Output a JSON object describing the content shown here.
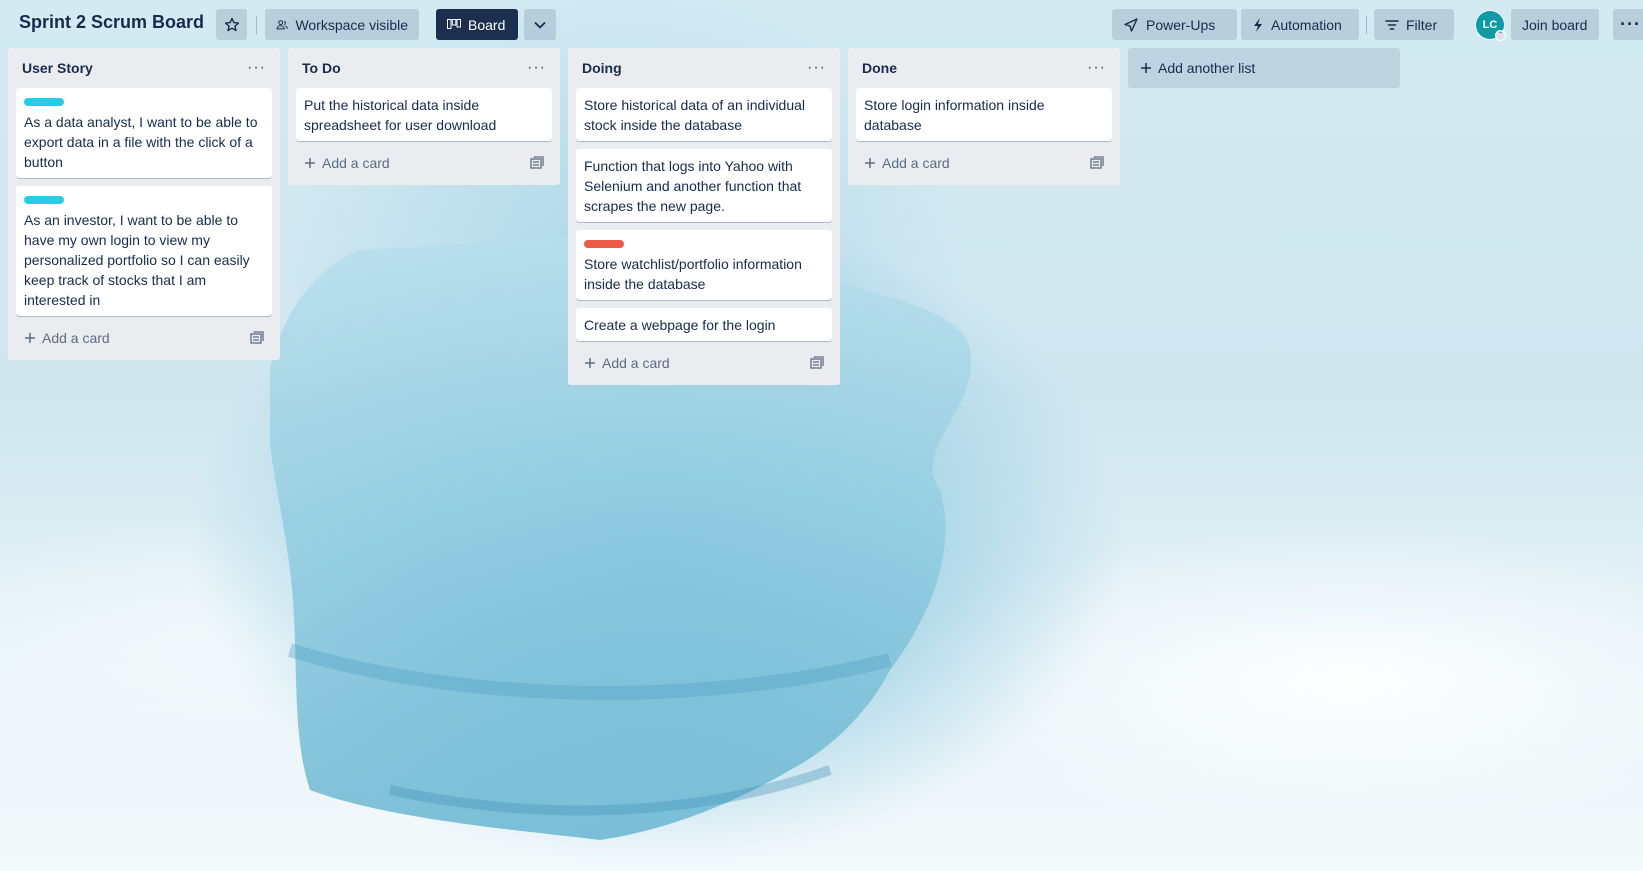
{
  "board": {
    "title": "Sprint 2 Scrum Board",
    "visibility_label": "Workspace visible",
    "view_label": "Board"
  },
  "toolbar": {
    "powerups_label": "Power-Ups",
    "automation_label": "Automation",
    "filter_label": "Filter",
    "avatar_initials": "LC",
    "join_label": "Join board"
  },
  "lists": [
    {
      "title": "User Story",
      "cards": [
        {
          "label_color": "#29cce5",
          "text": "As a data analyst, I want to be able to export data in a file with the click of a button"
        },
        {
          "label_color": "#29cce5",
          "text": "As an investor, I want to be able to have my own login to view my personalized portfolio so I can easily keep track of stocks that I am interested in"
        }
      ],
      "add_label": "Add a card"
    },
    {
      "title": "To Do",
      "cards": [
        {
          "text": "Put the historical data inside spreadsheet for user download"
        }
      ],
      "add_label": "Add a card"
    },
    {
      "title": "Doing",
      "cards": [
        {
          "text": "Store historical data of an individual stock inside the database"
        },
        {
          "text": "Function that logs into Yahoo with Selenium and another function that scrapes the new page."
        },
        {
          "label_color": "#eb5a46",
          "text": "Store watchlist/portfolio information inside the database"
        },
        {
          "text": "Create a webpage for the login"
        }
      ],
      "add_label": "Add a card"
    },
    {
      "title": "Done",
      "cards": [
        {
          "text": "Store login information inside database"
        }
      ],
      "add_label": "Add a card"
    }
  ],
  "add_list_label": "Add another list"
}
